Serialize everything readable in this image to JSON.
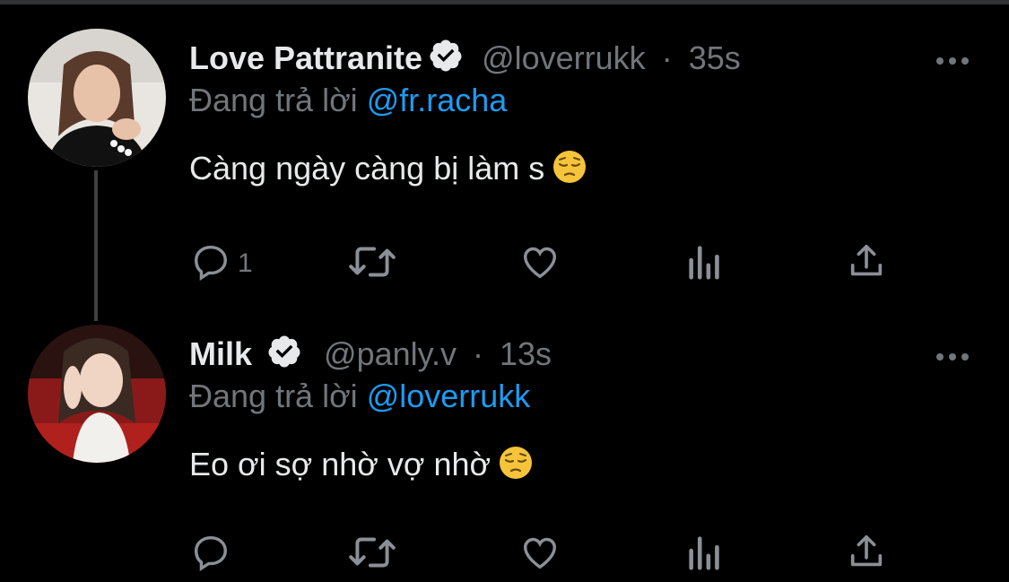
{
  "tweets": [
    {
      "name": "Love Pattranite",
      "handle": "@loverrukk",
      "separator": "·",
      "time": "35s",
      "reply_prefix": "Đang trả lời",
      "reply_to": "@fr.racha",
      "text": "Càng ngày càng bị làm s",
      "emoji": "pensive-face",
      "reply_count": "1",
      "avatar_colors": {
        "bg": "#e9e6e2",
        "hair": "#5a3a2a",
        "skin": "#e8c2a8",
        "shirt": "#111111"
      }
    },
    {
      "name": "Milk",
      "handle": "@panly.v",
      "separator": "·",
      "time": "13s",
      "reply_prefix": "Đang trả lời",
      "reply_to": "@loverrukk",
      "text": "Eo ơi sợ nhờ vợ nhờ",
      "emoji": "pensive-face",
      "reply_count": "",
      "avatar_colors": {
        "bg": "#8a1a1a",
        "hair": "#3a2a22",
        "skin": "#f0d4c4",
        "shirt": "#f2f0ec"
      }
    }
  ],
  "icons": {
    "verified": "verified-badge-icon",
    "more": "more-icon",
    "reply": "reply-icon",
    "retweet": "retweet-icon",
    "like": "like-icon",
    "views": "views-icon",
    "share": "share-icon"
  },
  "colors": {
    "background": "#000000",
    "text": "#e7e9ea",
    "muted": "#71767b",
    "link": "#1d9bf0"
  }
}
